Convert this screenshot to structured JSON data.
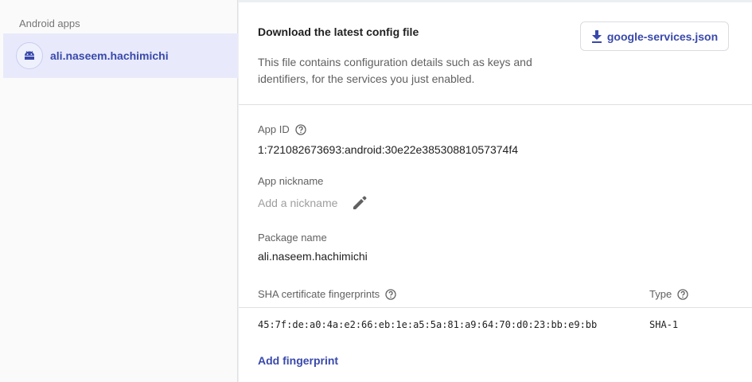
{
  "sidebar": {
    "heading": "Android apps",
    "items": [
      {
        "label": "ali.naseem.hachimichi",
        "icon": "android-icon",
        "selected": true
      }
    ]
  },
  "config": {
    "title": "Download the latest config file",
    "description": "This file contains configuration details such as keys and identifiers, for the services you just enabled.",
    "download_label": "google-services.json",
    "download_icon": "download-icon"
  },
  "details": {
    "app_id_label": "App ID",
    "app_id_value": "1:721082673693:android:30e22e38530881057374f4",
    "nickname_label": "App nickname",
    "nickname_placeholder": "Add a nickname",
    "package_label": "Package name",
    "package_value": "ali.naseem.hachimichi"
  },
  "fingerprints": {
    "header": "SHA certificate fingerprints",
    "type_header": "Type",
    "rows": [
      {
        "value": "45:7f:de:a0:4a:e2:66:eb:1e:a5:5a:81:a9:64:70:d0:23:bb:e9:bb",
        "type": "SHA-1"
      }
    ],
    "add_label": "Add fingerprint"
  },
  "colors": {
    "accent": "#3949ab",
    "selected_bg": "#e8eafb",
    "sidebar_bg": "#fafafa",
    "text_secondary": "#616161"
  }
}
